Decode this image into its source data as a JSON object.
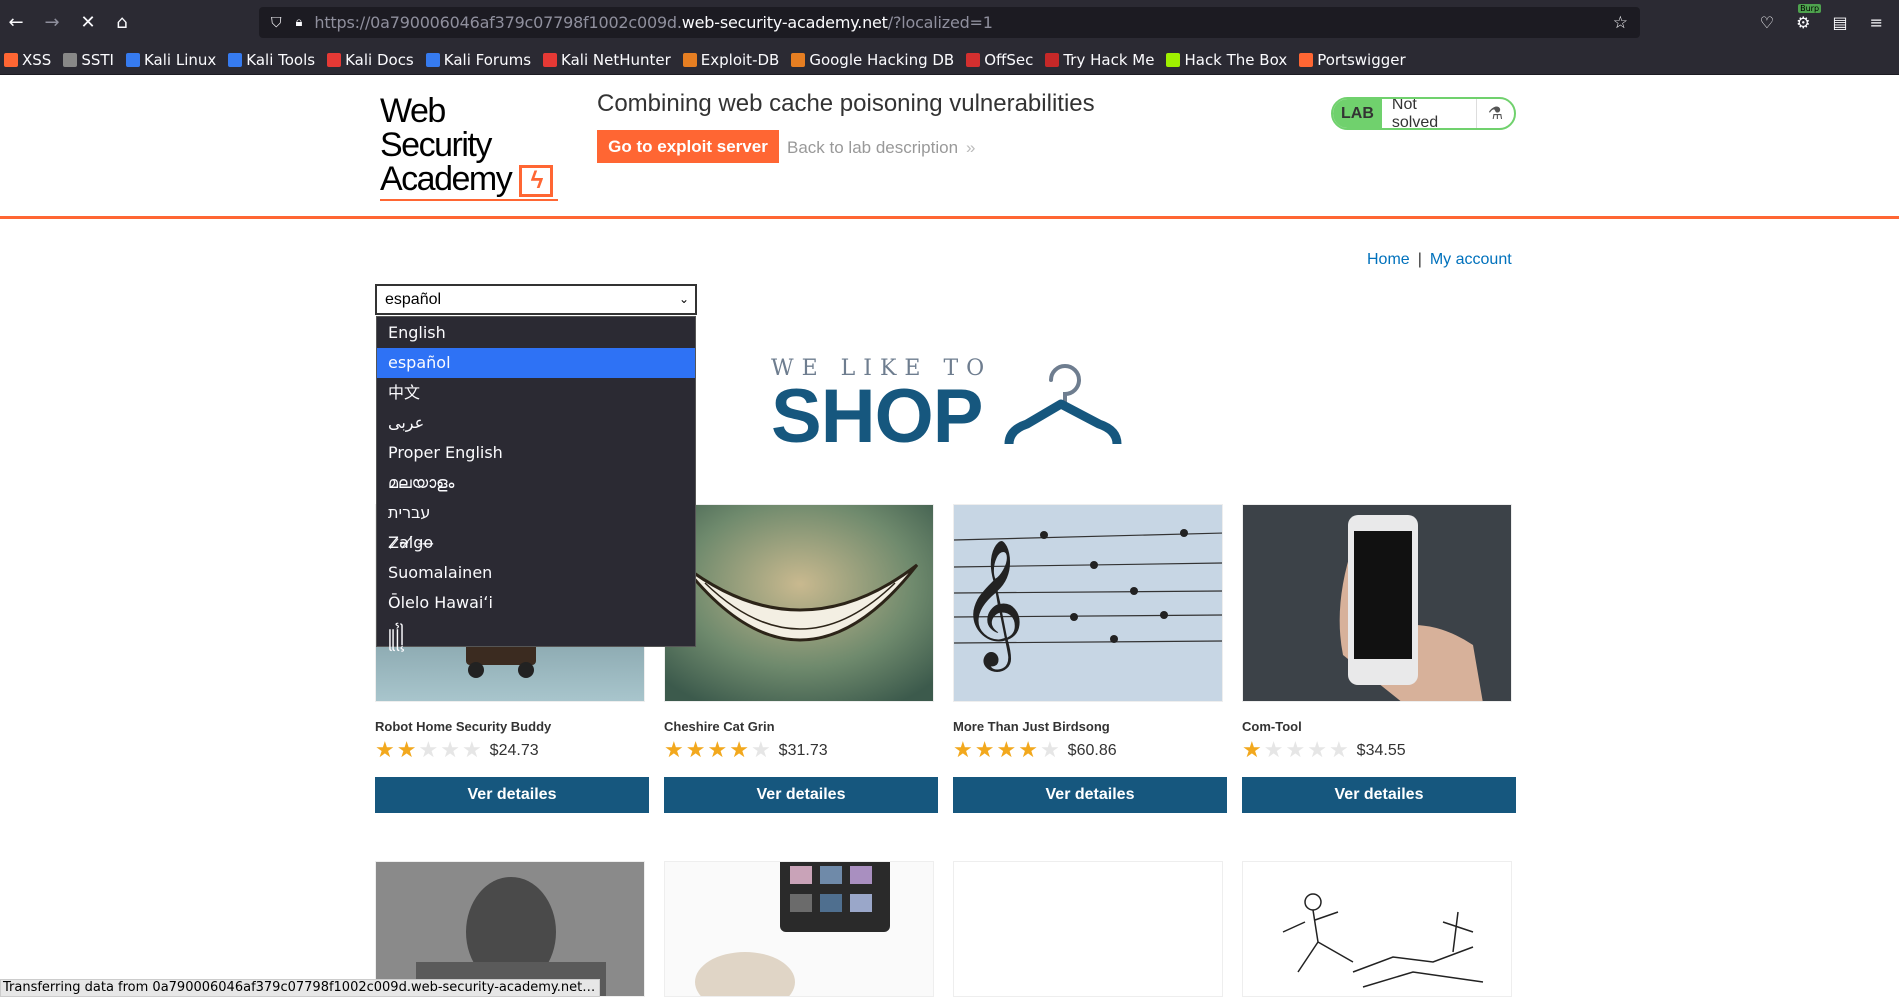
{
  "browser": {
    "url_prefix": "https://0a790006046af379c07798f1002c009d.",
    "url_host": "web-security-academy.net",
    "url_suffix": "/?localized=1",
    "burp_badge": "Burp",
    "bookmarks": [
      {
        "label": "XSS",
        "color": "#ff6633"
      },
      {
        "label": "SSTI",
        "color": "#888888"
      },
      {
        "label": "Kali Linux",
        "color": "#367bf0"
      },
      {
        "label": "Kali Tools",
        "color": "#367bf0"
      },
      {
        "label": "Kali Docs",
        "color": "#e53935"
      },
      {
        "label": "Kali Forums",
        "color": "#367bf0"
      },
      {
        "label": "Kali NetHunter",
        "color": "#e53935"
      },
      {
        "label": "Exploit-DB",
        "color": "#e67e22"
      },
      {
        "label": "Google Hacking DB",
        "color": "#e67e22"
      },
      {
        "label": "OffSec",
        "color": "#d32f2f"
      },
      {
        "label": "Try Hack Me",
        "color": "#c62828"
      },
      {
        "label": "Hack The Box",
        "color": "#9fef00"
      },
      {
        "label": "Portswigger",
        "color": "#ff6633"
      }
    ],
    "status_text": "Transferring data from 0a790006046af379c07798f1002c009d.web-security-academy.net…"
  },
  "lab": {
    "logo_line1": "Web Security",
    "logo_line2": "Academy",
    "title": "Combining web cache poisoning vulnerabilities",
    "exploit_button": "Go to exploit server",
    "back_link": "Back to lab description",
    "badge_lab": "LAB",
    "badge_state": "Not solved"
  },
  "nav": {
    "home": "Home",
    "separator": "|",
    "account": "My account"
  },
  "language": {
    "selected": "español",
    "options": [
      "English",
      "español",
      "中文",
      "عربى",
      "Proper English",
      "മലയാളം",
      "עברית",
      "Z̷a̴l̸g̵o̶",
      "Suomalainen",
      "Ōlelo Hawaiʻi",
      "꧋꧌꧍"
    ]
  },
  "hero": {
    "line1": "WE LIKE TO",
    "line2": "SHOP"
  },
  "products": [
    {
      "name": "Robot Home Security Buddy",
      "rating": 2,
      "price": "$24.73",
      "button": "Ver detailes"
    },
    {
      "name": "Cheshire Cat Grin",
      "rating": 4,
      "price": "$31.73",
      "button": "Ver detailes"
    },
    {
      "name": "More Than Just Birdsong",
      "rating": 4,
      "price": "$60.86",
      "button": "Ver detailes"
    },
    {
      "name": "Com-Tool",
      "rating": 1,
      "price": "$34.55",
      "button": "Ver detailes"
    }
  ]
}
